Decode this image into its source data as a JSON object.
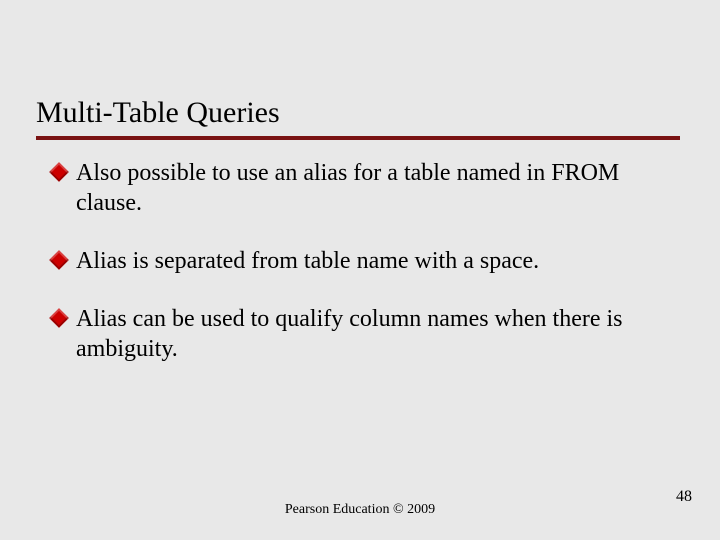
{
  "title": "Multi-Table Queries",
  "bullets": [
    "Also possible to use an alias for a table named in FROM clause.",
    "Alias is separated from table name with a space.",
    "Alias can be used to qualify column names when there is ambiguity."
  ],
  "footer": "Pearson Education © 2009",
  "page_number": "48"
}
